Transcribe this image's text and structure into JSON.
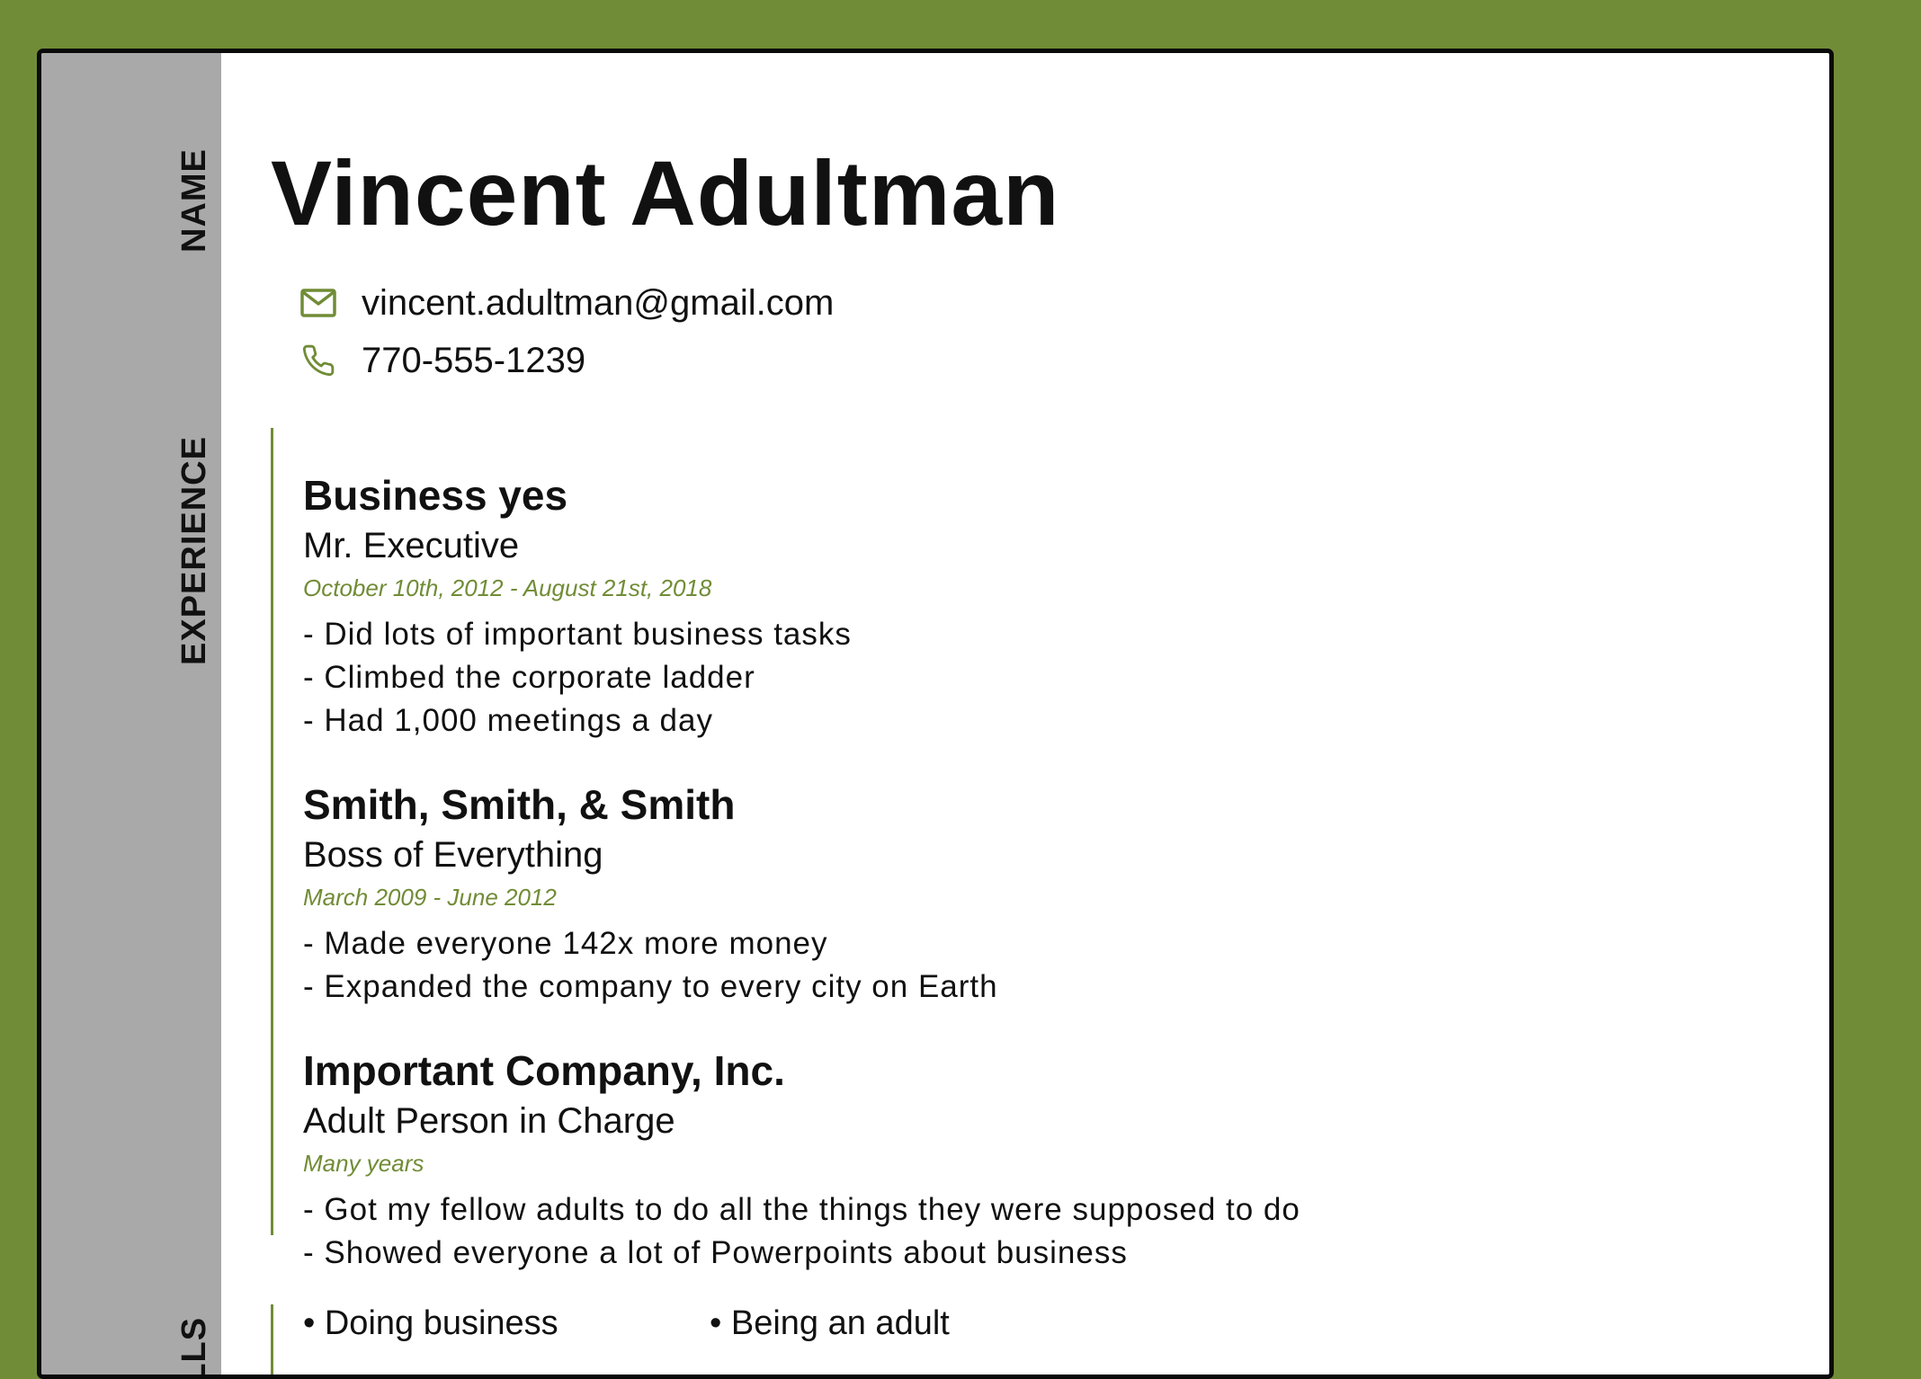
{
  "sidebar": {
    "name_label": "NAME",
    "experience_label": "EXPERIENCE",
    "skills_label": "SKILLS"
  },
  "header": {
    "name": "Vincent Adultman",
    "email": "vincent.adultman@gmail.com",
    "phone": "770-555-1239",
    "email_icon": "mail-icon",
    "phone_icon": "phone-icon"
  },
  "experience": [
    {
      "company": "Business yes",
      "title": "Mr. Executive",
      "dates": "October 10th, 2012 - August 21st, 2018",
      "bullets": [
        "- Did lots of important business tasks",
        "- Climbed the corporate ladder",
        "- Had 1,000 meetings a day"
      ]
    },
    {
      "company": "Smith, Smith, & Smith",
      "title": "Boss of Everything",
      "dates": "March 2009 - June 2012",
      "bullets": [
        "- Made everyone 142x more money",
        "- Expanded the company to every city on Earth"
      ]
    },
    {
      "company": "Important Company, Inc.",
      "title": "Adult Person in Charge",
      "dates": "Many years",
      "bullets": [
        "- Got my fellow adults to do all the things they were supposed to do",
        "- Showed everyone a lot of Powerpoints about business"
      ]
    }
  ],
  "skills": [
    "• Doing business",
    "• Being an adult"
  ],
  "colors": {
    "accent": "#718c36",
    "sidebar": "#a9a9a9",
    "page": "#ffffff"
  }
}
